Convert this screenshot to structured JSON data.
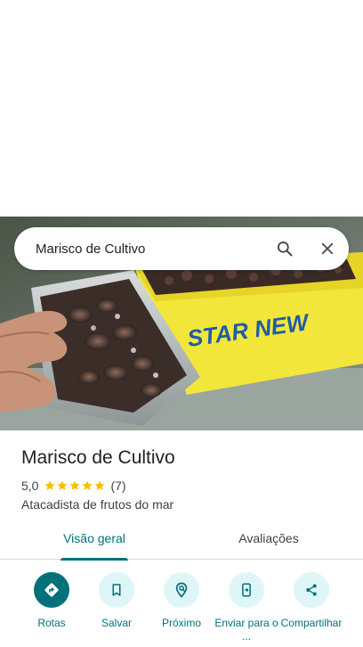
{
  "search": {
    "query": "Marisco de Cultivo",
    "search_icon": "search-icon",
    "close_icon": "close-icon"
  },
  "photo": {
    "box_text": "STAR NEW"
  },
  "place": {
    "name": "Marisco de Cultivo",
    "rating": "5,0",
    "stars": 5,
    "review_count": "(7)",
    "category": "Atacadista de frutos do mar"
  },
  "tabs": [
    {
      "label": "Visão geral",
      "active": true
    },
    {
      "label": "Avaliações",
      "active": false
    }
  ],
  "actions": [
    {
      "label": "Rotas",
      "icon": "directions-icon"
    },
    {
      "label": "Salvar",
      "icon": "bookmark-icon"
    },
    {
      "label": "Próximo",
      "icon": "nearby-icon"
    },
    {
      "label": "Enviar para o ...",
      "icon": "send-to-phone-icon"
    },
    {
      "label": "Compartilhar",
      "icon": "share-icon"
    }
  ],
  "colors": {
    "accent": "#00707a",
    "action_bg": "#dff6f8",
    "star": "#fbbc04"
  }
}
